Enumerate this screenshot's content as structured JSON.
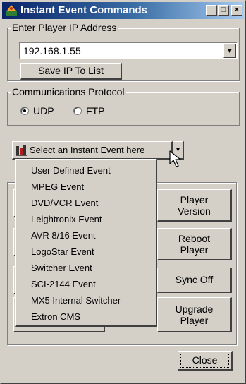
{
  "window": {
    "title": "Instant Event Commands",
    "minimize": "_",
    "maximize": "□",
    "close": "×"
  },
  "ip_group": {
    "label": "Enter Player IP Address",
    "ip_value": "192.168.1.55",
    "save_button": "Save IP To List"
  },
  "protocol_group": {
    "label": "Communications Protocol",
    "options": [
      {
        "label": "UDP",
        "selected": true
      },
      {
        "label": "FTP",
        "selected": false
      }
    ]
  },
  "event_select": {
    "label": "Select an Instant Event here",
    "arrow": "▾"
  },
  "event_menu": {
    "items": [
      "User Defined Event",
      "MPEG Event",
      "DVD/VCR Event",
      "Leightronix Event",
      "AVR 8/16 Event",
      "LogoStar Event",
      "Switcher Event",
      "SCI-2144 Event",
      "MX5 Internal Switcher",
      "Extron CMS"
    ]
  },
  "player_buttons": {
    "player_version": [
      "Player",
      "Version"
    ],
    "reboot_player": [
      "Reboot",
      "Player"
    ],
    "sync_off": "Sync Off",
    "upgrade_player": [
      "Upgrade",
      "Player"
    ]
  },
  "close_button": "Close"
}
